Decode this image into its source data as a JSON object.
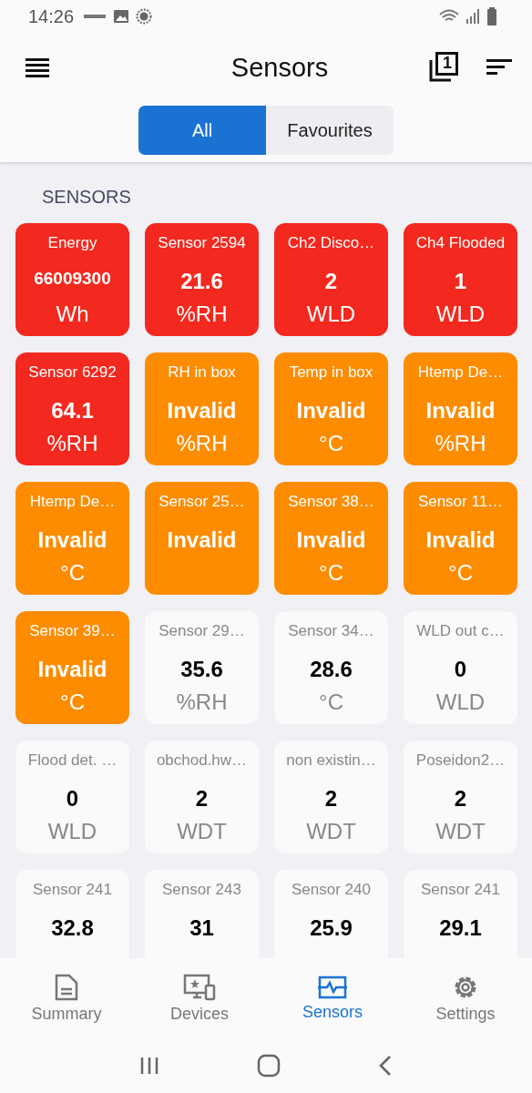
{
  "status_bar": {
    "time": "14:26"
  },
  "app_bar": {
    "title": "Sensors",
    "badge": "1"
  },
  "tabs": [
    {
      "label": "All",
      "selected": true
    },
    {
      "label": "Favourites",
      "selected": false
    }
  ],
  "section_title": "SENSORS",
  "tiles": [
    {
      "name": "Energy",
      "value": "66009300",
      "unit": "Wh",
      "kind": "alarm"
    },
    {
      "name": "Sensor 2594",
      "value": "21.6",
      "unit": "%RH",
      "kind": "alarm"
    },
    {
      "name": "Ch2 Disco…",
      "value": "2",
      "unit": "WLD",
      "kind": "alarm"
    },
    {
      "name": "Ch4 Flooded",
      "value": "1",
      "unit": "WLD",
      "kind": "alarm"
    },
    {
      "name": "Sensor 6292",
      "value": "64.1",
      "unit": "%RH",
      "kind": "alarm"
    },
    {
      "name": "RH in box",
      "value": "Invalid",
      "unit": "%RH",
      "kind": "invalid"
    },
    {
      "name": "Temp in box",
      "value": "Invalid",
      "unit": "°C",
      "kind": "invalid"
    },
    {
      "name": "Htemp De…",
      "value": "Invalid",
      "unit": "%RH",
      "kind": "invalid"
    },
    {
      "name": "Htemp De…",
      "value": "Invalid",
      "unit": "°C",
      "kind": "invalid"
    },
    {
      "name": "Sensor 25…",
      "value": "Invalid",
      "kind": "invalid"
    },
    {
      "name": "Sensor 38…",
      "value": "Invalid",
      "unit": "°C",
      "kind": "invalid"
    },
    {
      "name": "Sensor 11…",
      "value": "Invalid",
      "unit": "°C",
      "kind": "invalid"
    },
    {
      "name": "Sensor 39…",
      "value": "Invalid",
      "unit": "°C",
      "kind": "invalid"
    },
    {
      "name": "Sensor 29…",
      "value": "35.6",
      "unit": "%RH",
      "kind": "normal"
    },
    {
      "name": "Sensor 34…",
      "value": "28.6",
      "unit": "°C",
      "kind": "normal"
    },
    {
      "name": "WLD out c…",
      "value": "0",
      "unit": "WLD",
      "kind": "normal"
    },
    {
      "name": "Flood det. …",
      "value": "0",
      "unit": "WLD",
      "kind": "normal"
    },
    {
      "name": "obchod.hw…",
      "value": "2",
      "unit": "WDT",
      "kind": "normal"
    },
    {
      "name": "non existin…",
      "value": "2",
      "unit": "WDT",
      "kind": "normal"
    },
    {
      "name": "Poseidon2…",
      "value": "2",
      "unit": "WDT",
      "kind": "normal"
    },
    {
      "name": "Sensor 241",
      "value": "32.8",
      "kind": "normal"
    },
    {
      "name": "Sensor 243",
      "value": "31",
      "kind": "normal"
    },
    {
      "name": "Sensor 240",
      "value": "25.9",
      "kind": "normal"
    },
    {
      "name": "Sensor 241",
      "value": "29.1",
      "kind": "normal"
    }
  ],
  "bottom_nav": [
    {
      "label": "Summary",
      "kind": "summary",
      "selected": false
    },
    {
      "label": "Devices",
      "kind": "devices",
      "selected": false
    },
    {
      "label": "Sensors",
      "kind": "sensors",
      "selected": true
    },
    {
      "label": "Settings",
      "kind": "settings",
      "selected": false
    }
  ]
}
